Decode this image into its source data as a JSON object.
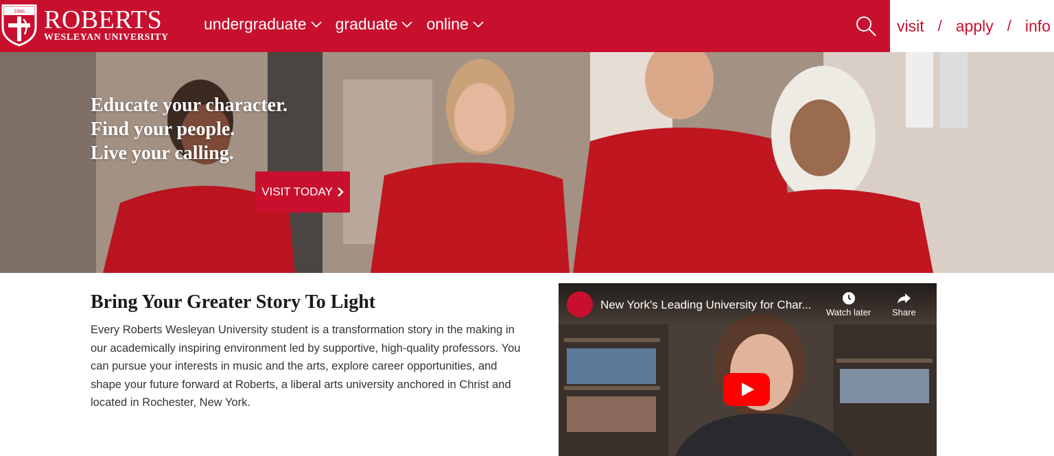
{
  "header": {
    "logo": {
      "name": "ROBERTS",
      "sub": "WESLEYAN UNIVERSITY",
      "year": "1866"
    },
    "nav": [
      {
        "label": "undergraduate"
      },
      {
        "label": "graduate"
      },
      {
        "label": "online"
      }
    ],
    "search_icon": "search-icon",
    "utility": {
      "visit": "visit",
      "apply": "apply",
      "info": "info",
      "sep": "/"
    }
  },
  "hero": {
    "line1": "Educate your character.",
    "line2": "Find your people.",
    "line3": "Live your calling.",
    "button": "VISIT TODAY"
  },
  "story": {
    "title": "Bring Your Greater Story To Light",
    "body": "Every Roberts Wesleyan University student is a transformation story in the making in our academically inspiring environment led by supportive, high-quality professors. You can pursue your interests in music and the arts, explore career opportunities, and shape your future forward at Roberts, a liberal arts university anchored in Christ and located in Rochester, New York."
  },
  "video": {
    "title": "New York's Leading University for Char...",
    "watch_later": "Watch later",
    "share": "Share"
  },
  "colors": {
    "brand": "#c8102e",
    "white": "#ffffff"
  }
}
